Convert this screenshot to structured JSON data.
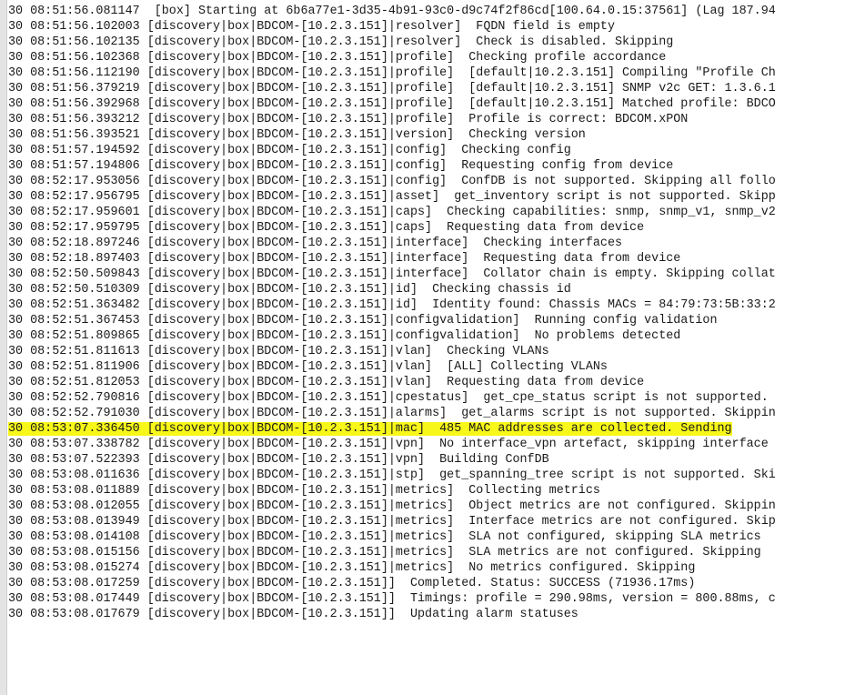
{
  "log": {
    "highlight_color": "#f7f71a",
    "lines": [
      {
        "ts": "30 08:51:56.081147",
        "src": "  [box]",
        "msg": " Starting at 6b6a77e1-3d35-4b91-93c0-d9c74f2f86cd[100.64.0.15:37561] (Lag 187.94",
        "highlight": false
      },
      {
        "ts": "30 08:51:56.102003",
        "src": " [discovery|box|BDCOM-[10.2.3.151]|resolver]",
        "msg": "  FQDN field is empty",
        "highlight": false
      },
      {
        "ts": "30 08:51:56.102135",
        "src": " [discovery|box|BDCOM-[10.2.3.151]|resolver]",
        "msg": "  Check is disabled. Skipping",
        "highlight": false
      },
      {
        "ts": "30 08:51:56.102368",
        "src": " [discovery|box|BDCOM-[10.2.3.151]|profile]",
        "msg": "  Checking profile accordance",
        "highlight": false
      },
      {
        "ts": "30 08:51:56.112190",
        "src": " [discovery|box|BDCOM-[10.2.3.151]|profile]",
        "msg": "  [default|10.2.3.151] Compiling \"Profile Ch",
        "highlight": false
      },
      {
        "ts": "30 08:51:56.379219",
        "src": " [discovery|box|BDCOM-[10.2.3.151]|profile]",
        "msg": "  [default|10.2.3.151] SNMP v2c GET: 1.3.6.1",
        "highlight": false
      },
      {
        "ts": "30 08:51:56.392968",
        "src": " [discovery|box|BDCOM-[10.2.3.151]|profile]",
        "msg": "  [default|10.2.3.151] Matched profile: BDCO",
        "highlight": false
      },
      {
        "ts": "30 08:51:56.393212",
        "src": " [discovery|box|BDCOM-[10.2.3.151]|profile]",
        "msg": "  Profile is correct: BDCOM.xPON",
        "highlight": false
      },
      {
        "ts": "30 08:51:56.393521",
        "src": " [discovery|box|BDCOM-[10.2.3.151]|version]",
        "msg": "  Checking version",
        "highlight": false
      },
      {
        "ts": "30 08:51:57.194592",
        "src": " [discovery|box|BDCOM-[10.2.3.151]|config]",
        "msg": "  Checking config",
        "highlight": false
      },
      {
        "ts": "30 08:51:57.194806",
        "src": " [discovery|box|BDCOM-[10.2.3.151]|config]",
        "msg": "  Requesting config from device",
        "highlight": false
      },
      {
        "ts": "30 08:52:17.953056",
        "src": " [discovery|box|BDCOM-[10.2.3.151]|config]",
        "msg": "  ConfDB is not supported. Skipping all follo",
        "highlight": false
      },
      {
        "ts": "30 08:52:17.956795",
        "src": " [discovery|box|BDCOM-[10.2.3.151]|asset]",
        "msg": "  get_inventory script is not supported. Skipp",
        "highlight": false
      },
      {
        "ts": "30 08:52:17.959601",
        "src": " [discovery|box|BDCOM-[10.2.3.151]|caps]",
        "msg": "  Checking capabilities: snmp, snmp_v1, snmp_v2",
        "highlight": false
      },
      {
        "ts": "30 08:52:17.959795",
        "src": " [discovery|box|BDCOM-[10.2.3.151]|caps]",
        "msg": "  Requesting data from device",
        "highlight": false
      },
      {
        "ts": "30 08:52:18.897246",
        "src": " [discovery|box|BDCOM-[10.2.3.151]|interface]",
        "msg": "  Checking interfaces",
        "highlight": false
      },
      {
        "ts": "30 08:52:18.897403",
        "src": " [discovery|box|BDCOM-[10.2.3.151]|interface]",
        "msg": "  Requesting data from device",
        "highlight": false
      },
      {
        "ts": "30 08:52:50.509843",
        "src": " [discovery|box|BDCOM-[10.2.3.151]|interface]",
        "msg": "  Collator chain is empty. Skipping collat",
        "highlight": false
      },
      {
        "ts": "30 08:52:50.510309",
        "src": " [discovery|box|BDCOM-[10.2.3.151]|id]",
        "msg": "  Checking chassis id",
        "highlight": false
      },
      {
        "ts": "30 08:52:51.363482",
        "src": " [discovery|box|BDCOM-[10.2.3.151]|id]",
        "msg": "  Identity found: Chassis MACs = 84:79:73:5B:33:2",
        "highlight": false
      },
      {
        "ts": "30 08:52:51.367453",
        "src": " [discovery|box|BDCOM-[10.2.3.151]|configvalidation]",
        "msg": "  Running config validation",
        "highlight": false
      },
      {
        "ts": "30 08:52:51.809865",
        "src": " [discovery|box|BDCOM-[10.2.3.151]|configvalidation]",
        "msg": "  No problems detected",
        "highlight": false
      },
      {
        "ts": "30 08:52:51.811613",
        "src": " [discovery|box|BDCOM-[10.2.3.151]|vlan]",
        "msg": "  Checking VLANs",
        "highlight": false
      },
      {
        "ts": "30 08:52:51.811906",
        "src": " [discovery|box|BDCOM-[10.2.3.151]|vlan]",
        "msg": "  [ALL] Collecting VLANs",
        "highlight": false
      },
      {
        "ts": "30 08:52:51.812053",
        "src": " [discovery|box|BDCOM-[10.2.3.151]|vlan]",
        "msg": "  Requesting data from device",
        "highlight": false
      },
      {
        "ts": "30 08:52:52.790816",
        "src": " [discovery|box|BDCOM-[10.2.3.151]|cpestatus]",
        "msg": "  get_cpe_status script is not supported.",
        "highlight": false
      },
      {
        "ts": "30 08:52:52.791030",
        "src": " [discovery|box|BDCOM-[10.2.3.151]|alarms]",
        "msg": "  get_alarms script is not supported. Skippin",
        "highlight": false
      },
      {
        "ts": "30 08:53:07.336450",
        "src": " [discovery|box|BDCOM-[10.2.3.151]|mac]",
        "msg": "  485 MAC addresses are collected. Sending",
        "highlight": true
      },
      {
        "ts": "30 08:53:07.338782",
        "src": " [discovery|box|BDCOM-[10.2.3.151]|vpn]",
        "msg": "  No interface_vpn artefact, skipping interface",
        "highlight": false
      },
      {
        "ts": "30 08:53:07.522393",
        "src": " [discovery|box|BDCOM-[10.2.3.151]|vpn]",
        "msg": "  Building ConfDB",
        "highlight": false
      },
      {
        "ts": "30 08:53:08.011636",
        "src": " [discovery|box|BDCOM-[10.2.3.151]|stp]",
        "msg": "  get_spanning_tree script is not supported. Ski",
        "highlight": false
      },
      {
        "ts": "30 08:53:08.011889",
        "src": " [discovery|box|BDCOM-[10.2.3.151]|metrics]",
        "msg": "  Collecting metrics",
        "highlight": false
      },
      {
        "ts": "30 08:53:08.012055",
        "src": " [discovery|box|BDCOM-[10.2.3.151]|metrics]",
        "msg": "  Object metrics are not configured. Skippin",
        "highlight": false
      },
      {
        "ts": "30 08:53:08.013949",
        "src": " [discovery|box|BDCOM-[10.2.3.151]|metrics]",
        "msg": "  Interface metrics are not configured. Skip",
        "highlight": false
      },
      {
        "ts": "30 08:53:08.014108",
        "src": " [discovery|box|BDCOM-[10.2.3.151]|metrics]",
        "msg": "  SLA not configured, skipping SLA metrics",
        "highlight": false
      },
      {
        "ts": "30 08:53:08.015156",
        "src": " [discovery|box|BDCOM-[10.2.3.151]|metrics]",
        "msg": "  SLA metrics are not configured. Skipping",
        "highlight": false
      },
      {
        "ts": "30 08:53:08.015274",
        "src": " [discovery|box|BDCOM-[10.2.3.151]|metrics]",
        "msg": "  No metrics configured. Skipping",
        "highlight": false
      },
      {
        "ts": "30 08:53:08.017259",
        "src": " [discovery|box|BDCOM-[10.2.3.151]]",
        "msg": "  Completed. Status: SUCCESS (71936.17ms)",
        "highlight": false
      },
      {
        "ts": "30 08:53:08.017449",
        "src": " [discovery|box|BDCOM-[10.2.3.151]]",
        "msg": "  Timings: profile = 290.98ms, version = 800.88ms, c",
        "highlight": false
      },
      {
        "ts": "30 08:53:08.017679",
        "src": " [discovery|box|BDCOM-[10.2.3.151]]",
        "msg": "  Updating alarm statuses",
        "highlight": false
      }
    ]
  }
}
